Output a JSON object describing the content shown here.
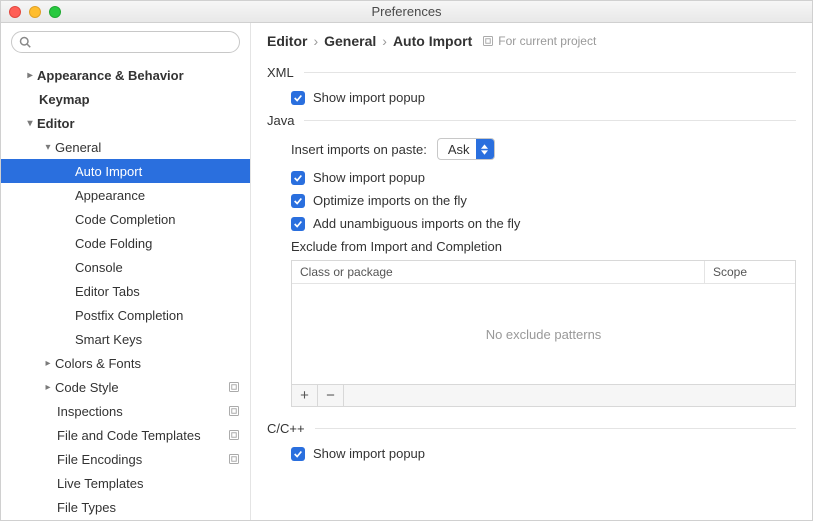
{
  "window": {
    "title": "Preferences"
  },
  "search": {
    "placeholder": ""
  },
  "sidebar": {
    "items": [
      {
        "label": "Appearance & Behavior",
        "level": 0,
        "arrow": "right",
        "bold": true
      },
      {
        "label": "Keymap",
        "level": 0,
        "bold": true
      },
      {
        "label": "Editor",
        "level": 0,
        "arrow": "down",
        "bold": true
      },
      {
        "label": "General",
        "level": 1,
        "arrow": "down"
      },
      {
        "label": "Auto Import",
        "level": 2,
        "selected": true
      },
      {
        "label": "Appearance",
        "level": 2
      },
      {
        "label": "Code Completion",
        "level": 2
      },
      {
        "label": "Code Folding",
        "level": 2
      },
      {
        "label": "Console",
        "level": 2
      },
      {
        "label": "Editor Tabs",
        "level": 2
      },
      {
        "label": "Postfix Completion",
        "level": 2
      },
      {
        "label": "Smart Keys",
        "level": 2
      },
      {
        "label": "Colors & Fonts",
        "level": 1,
        "arrow": "right"
      },
      {
        "label": "Code Style",
        "level": 1,
        "arrow": "right",
        "proj": true
      },
      {
        "label": "Inspections",
        "level": 1,
        "proj": true
      },
      {
        "label": "File and Code Templates",
        "level": 1,
        "proj": true
      },
      {
        "label": "File Encodings",
        "level": 1,
        "proj": true
      },
      {
        "label": "Live Templates",
        "level": 1
      },
      {
        "label": "File Types",
        "level": 1
      }
    ]
  },
  "breadcrumb": {
    "parts": [
      "Editor",
      "General",
      "Auto Import"
    ],
    "tag": "For current project"
  },
  "sections": {
    "xml": {
      "title": "XML",
      "show_popup": "Show import popup"
    },
    "java": {
      "title": "Java",
      "paste_label": "Insert imports on paste:",
      "paste_value": "Ask",
      "show_popup": "Show import popup",
      "optimize": "Optimize imports on the fly",
      "unambiguous": "Add unambiguous imports on the fly",
      "exclude_head": "Exclude from Import and Completion",
      "col_class": "Class or package",
      "col_scope": "Scope",
      "empty": "No exclude patterns"
    },
    "cpp": {
      "title": "C/C++",
      "show_popup": "Show import popup"
    }
  }
}
